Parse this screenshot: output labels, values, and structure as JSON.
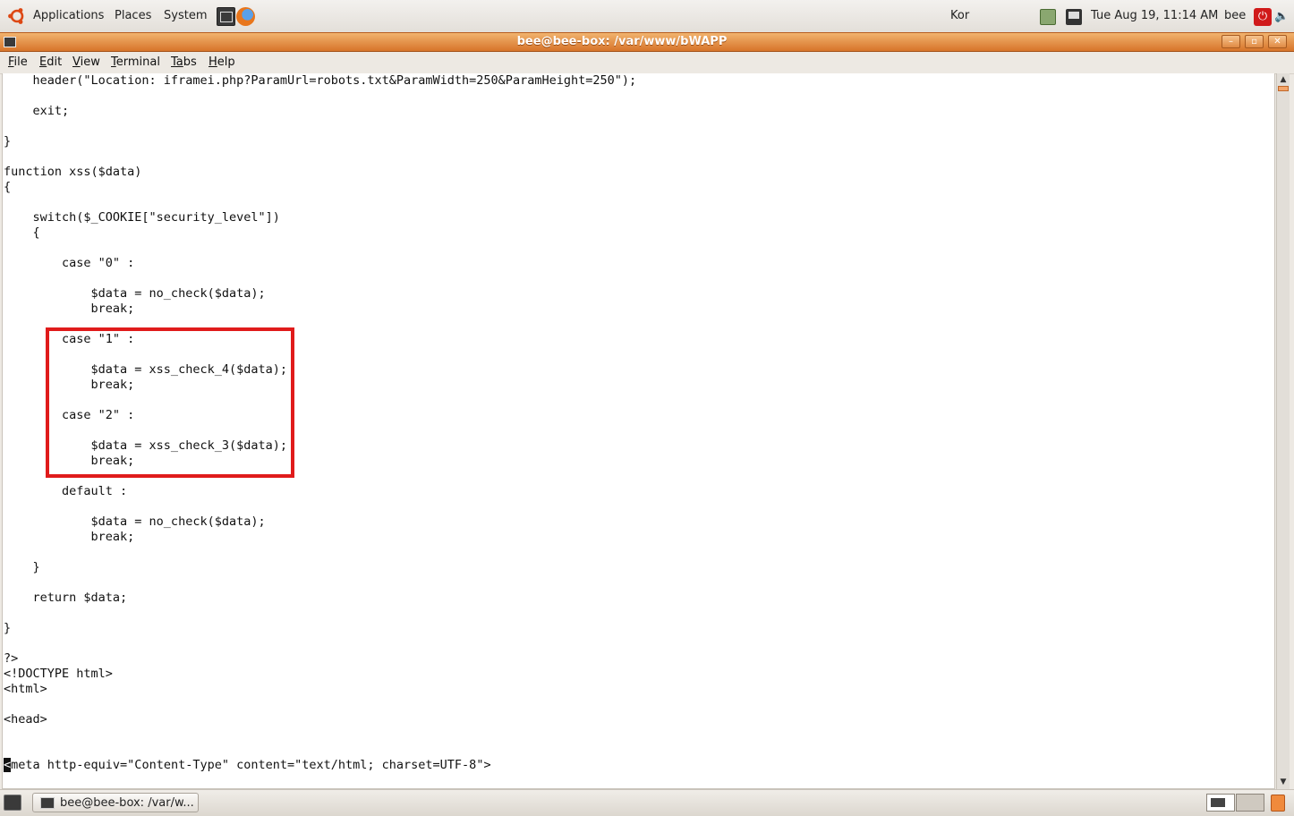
{
  "top_panel": {
    "menus": [
      "Applications",
      "Places",
      "System"
    ],
    "keyboard_layout": "Kor",
    "datetime": "Tue Aug 19, 11:14 AM",
    "user": "bee"
  },
  "window": {
    "title": "bee@bee-box: /var/www/bWAPP",
    "buttons": [
      "minimize",
      "maximize",
      "close"
    ]
  },
  "menubar": {
    "items": [
      {
        "mnemonic": "F",
        "rest": "ile"
      },
      {
        "mnemonic": "E",
        "rest": "dit"
      },
      {
        "mnemonic": "V",
        "rest": "iew"
      },
      {
        "mnemonic": "T",
        "rest": "erminal"
      },
      {
        "mnemonic": "Ta",
        "rest": "bs"
      },
      {
        "mnemonic": "H",
        "rest": "elp"
      }
    ]
  },
  "terminal": {
    "lines": [
      "    header(\"Location: iframei.php?ParamUrl=robots.txt&ParamWidth=250&ParamHeight=250\");",
      "",
      "    exit;",
      "",
      "}",
      "",
      "function xss($data)",
      "{",
      "",
      "    switch($_COOKIE[\"security_level\"])",
      "    {",
      "",
      "        case \"0\" :",
      "",
      "            $data = no_check($data);",
      "            break;",
      "",
      "        case \"1\" :",
      "",
      "            $data = xss_check_4($data);",
      "            break;",
      "",
      "        case \"2\" :",
      "",
      "            $data = xss_check_3($data);",
      "            break;",
      "",
      "        default :",
      "",
      "            $data = no_check($data);",
      "            break;",
      "",
      "    }",
      "",
      "    return $data;",
      "",
      "}",
      "",
      "?>",
      "<!DOCTYPE html>",
      "<html>",
      "",
      "<head>",
      "",
      ""
    ],
    "last_line_cursor_char": "<",
    "last_line_rest": "meta http-equiv=\"Content-Type\" content=\"text/html; charset=UTF-8\">"
  },
  "taskbar": {
    "task_label": "bee@bee-box: /var/w..."
  },
  "colors": {
    "titlebar": "#d7742a",
    "highlight_box": "#e01b1b"
  }
}
